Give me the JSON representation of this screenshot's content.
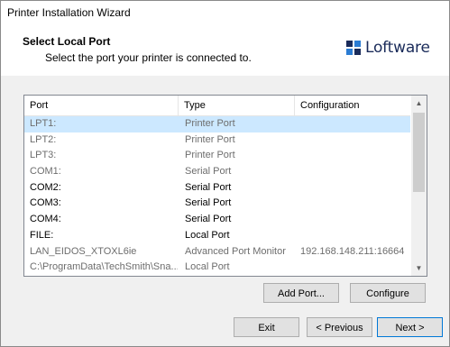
{
  "window": {
    "title": "Printer Installation Wizard"
  },
  "header": {
    "heading": "Select Local Port",
    "subtitle": "Select the port your printer is connected to.",
    "logo_text": "Loftware",
    "logo_color": "#1a2b5a"
  },
  "ports": {
    "columns": [
      "Port",
      "Type",
      "Configuration"
    ],
    "rows": [
      {
        "port": "LPT1:",
        "type": "Printer Port",
        "config": "",
        "state": "dim",
        "selected": true
      },
      {
        "port": "LPT2:",
        "type": "Printer Port",
        "config": "",
        "state": "dim"
      },
      {
        "port": "LPT3:",
        "type": "Printer Port",
        "config": "",
        "state": "dim"
      },
      {
        "port": "COM1:",
        "type": "Serial Port",
        "config": "",
        "state": "dim"
      },
      {
        "port": "COM2:",
        "type": "Serial Port",
        "config": "",
        "state": "bright"
      },
      {
        "port": "COM3:",
        "type": "Serial Port",
        "config": "",
        "state": "bright"
      },
      {
        "port": "COM4:",
        "type": "Serial Port",
        "config": "",
        "state": "bright"
      },
      {
        "port": "FILE:",
        "type": "Local Port",
        "config": "",
        "state": "bright"
      },
      {
        "port": "LAN_EIDOS_XTOXL6ie",
        "type": "Advanced Port Monitor",
        "config": "192.168.148.211:16664",
        "state": "dim"
      },
      {
        "port": "C:\\ProgramData\\TechSmith\\Sna...",
        "type": "Local Port",
        "config": "",
        "state": "dim"
      }
    ],
    "selected_color": "#cce8ff"
  },
  "buttons": {
    "add_port": "Add Port...",
    "configure": "Configure",
    "exit": "Exit",
    "previous": "< Previous",
    "next": "Next >"
  },
  "icons": {
    "logo": "loftware-logo-icon",
    "scroll_up": "scroll-up-arrow-icon",
    "scroll_down": "scroll-down-arrow-icon"
  }
}
